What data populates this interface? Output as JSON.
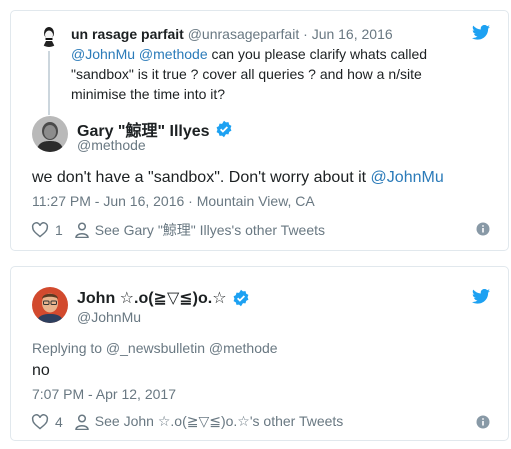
{
  "colors": {
    "link": "#2b7bb9",
    "muted": "#697882",
    "text": "#1c2022",
    "border": "#e1e8ed",
    "twitter_blue": "#1da1f2"
  },
  "tweet1": {
    "parent": {
      "name": "un rasage parfait",
      "handle": "@unrasageparfait",
      "separator": "·",
      "date": "Jun 16, 2016",
      "mention1": "@JohnMu",
      "mention2": "@methode",
      "text_rest": " can you please clarify whats called \"sandbox\" is it true ? cover all queries ? and how a n/site minimise the time into it?"
    },
    "author": {
      "name": "Gary \"鯨理\" Illyes",
      "handle": "@methode",
      "verified_icon": "verified-badge-icon"
    },
    "text": "we don't have a \"sandbox\". Don't worry about it ",
    "mention": "@JohnMu",
    "timestamp": "11:27 PM - Jun 16, 2016 · Mountain View, CA",
    "likes": "1",
    "other_tweets": "See Gary \"鯨理\" Illyes's other Tweets"
  },
  "tweet2": {
    "author": {
      "name": "John ☆.o(≧▽≦)o.☆",
      "handle": "@JohnMu",
      "verified_icon": "verified-badge-icon"
    },
    "replying_to": "Replying to @_newsbulletin @methode",
    "text": "no",
    "timestamp": "7:07 PM - Apr 12, 2017",
    "likes": "4",
    "other_tweets": "See John ☆.o(≧▽≦)o.☆'s other Tweets"
  }
}
